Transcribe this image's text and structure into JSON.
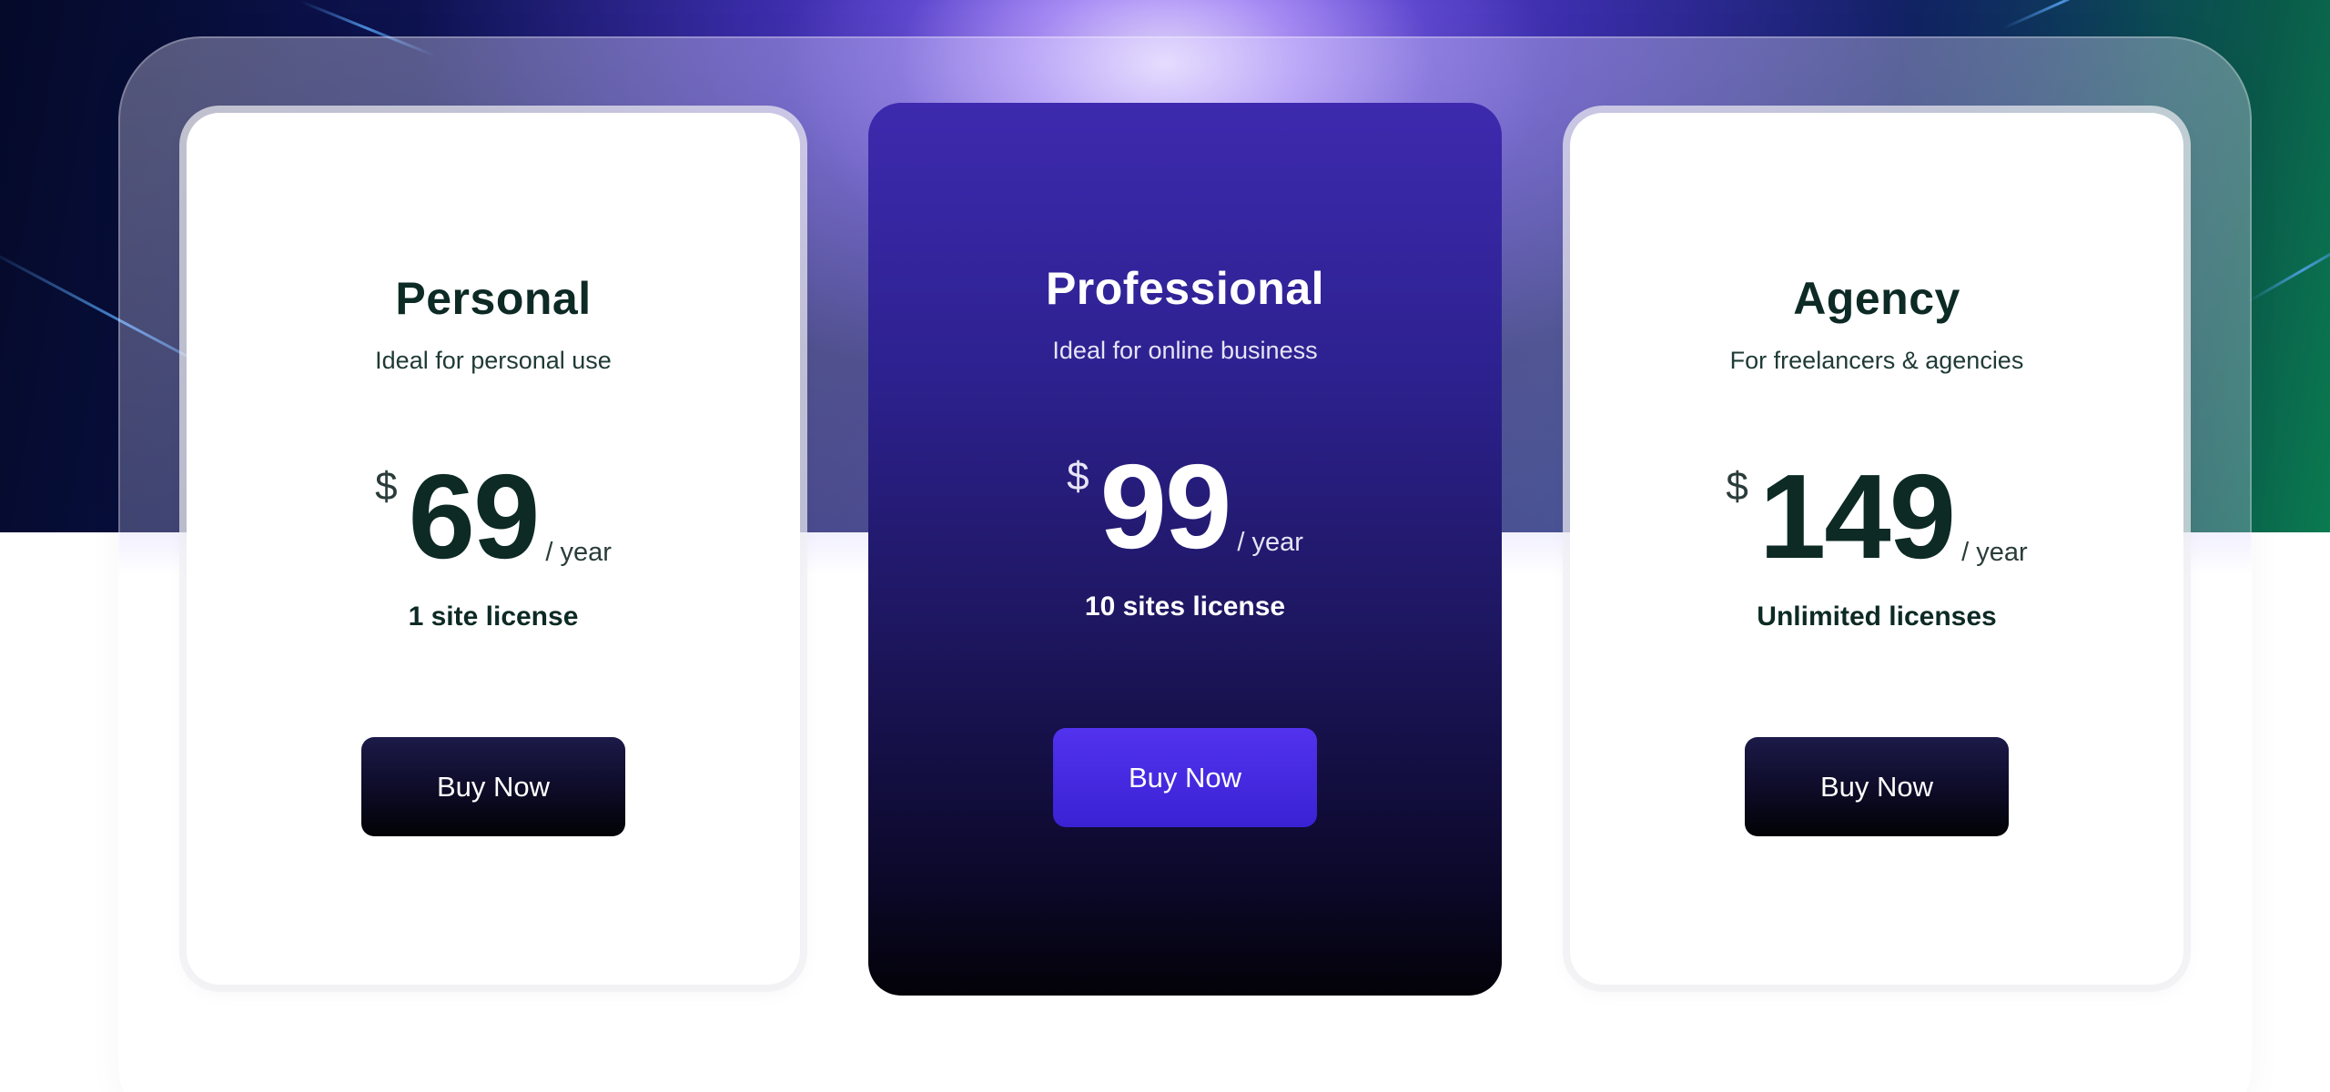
{
  "colors": {
    "accent": "#4a2de6",
    "featured_card_top": "#3d2aae",
    "featured_card_bottom": "#030208",
    "dark_button": "#0d0b26",
    "heading_text": "#0d2a25"
  },
  "plans": [
    {
      "name": "Personal",
      "description": "Ideal for personal use",
      "currency": "$",
      "amount": "69",
      "period": "/ year",
      "license": "1 site license",
      "button_label": "Buy Now"
    },
    {
      "name": "Professional",
      "description": "Ideal for online business",
      "currency": "$",
      "amount": "99",
      "period": "/ year",
      "license": "10 sites license",
      "button_label": "Buy Now"
    },
    {
      "name": "Agency",
      "description": "For freelancers & agencies",
      "currency": "$",
      "amount": "149",
      "period": "/ year",
      "license": "Unlimited licenses",
      "button_label": "Buy Now"
    }
  ]
}
